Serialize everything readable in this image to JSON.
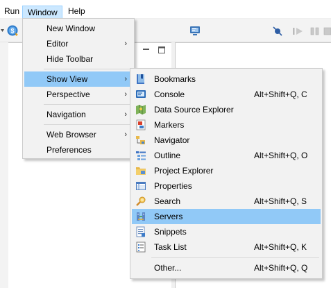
{
  "menubar": {
    "items": [
      {
        "label": "Run"
      },
      {
        "label": "Window"
      },
      {
        "label": "Help"
      }
    ]
  },
  "window_menu": {
    "items": [
      {
        "label": "New Window",
        "has_submenu": false
      },
      {
        "label": "Editor",
        "has_submenu": true
      },
      {
        "label": "Hide Toolbar",
        "has_submenu": false
      },
      {
        "label": "Show View",
        "has_submenu": true,
        "highlighted": true
      },
      {
        "label": "Perspective",
        "has_submenu": true
      },
      {
        "label": "Navigation",
        "has_submenu": true
      },
      {
        "label": "Web Browser",
        "has_submenu": true
      },
      {
        "label": "Preferences",
        "has_submenu": false
      }
    ]
  },
  "show_view_menu": {
    "items": [
      {
        "label": "Bookmarks",
        "shortcut": "",
        "icon": "bookmarks-icon"
      },
      {
        "label": "Console",
        "shortcut": "Alt+Shift+Q, C",
        "icon": "console-icon"
      },
      {
        "label": "Data Source Explorer",
        "shortcut": "",
        "icon": "data-source-explorer-icon"
      },
      {
        "label": "Markers",
        "shortcut": "",
        "icon": "markers-icon"
      },
      {
        "label": "Navigator",
        "shortcut": "",
        "icon": "navigator-icon"
      },
      {
        "label": "Outline",
        "shortcut": "Alt+Shift+Q, O",
        "icon": "outline-icon"
      },
      {
        "label": "Project Explorer",
        "shortcut": "",
        "icon": "project-explorer-icon"
      },
      {
        "label": "Properties",
        "shortcut": "",
        "icon": "properties-icon"
      },
      {
        "label": "Search",
        "shortcut": "Alt+Shift+Q, S",
        "icon": "search-icon"
      },
      {
        "label": "Servers",
        "shortcut": "",
        "icon": "servers-icon",
        "highlighted": true
      },
      {
        "label": "Snippets",
        "shortcut": "",
        "icon": "snippets-icon"
      },
      {
        "label": "Task List",
        "shortcut": "Alt+Shift+Q, K",
        "icon": "task-list-icon"
      },
      {
        "label": "Other...",
        "shortcut": "Alt+Shift+Q, Q",
        "icon": ""
      }
    ]
  },
  "colors": {
    "menubar_active_bg": "#cce8ff",
    "menu_highlight_bg": "#91c9f7",
    "menu_bg": "#f2f2f2"
  },
  "arrow_glyph": "›"
}
